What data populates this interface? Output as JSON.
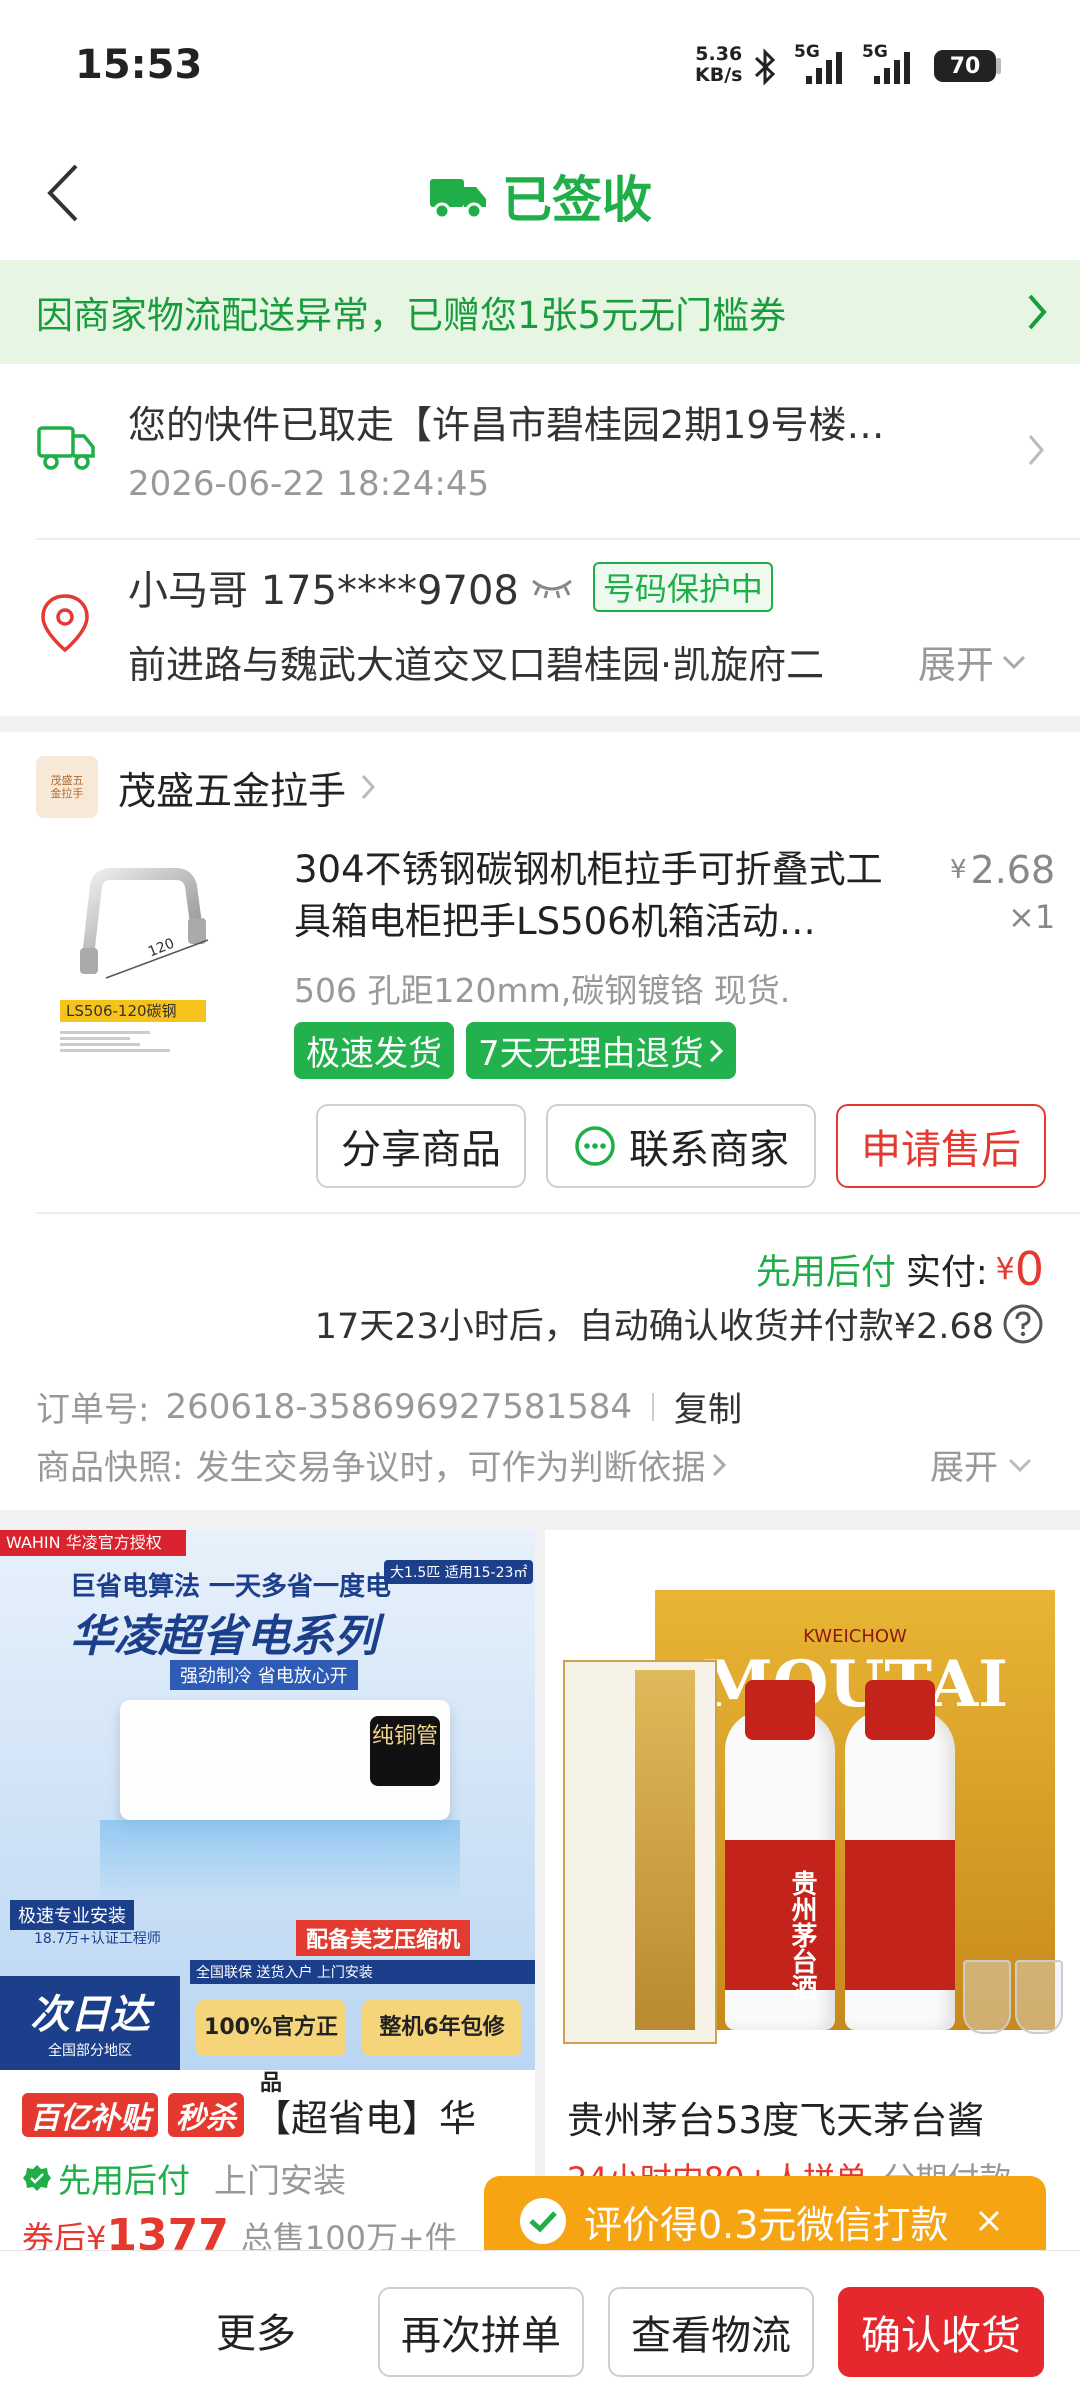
{
  "status_bar": {
    "time": "15:53",
    "net_speed_top": "5.36",
    "net_speed_bottom": "KB/s",
    "sig1": "5G",
    "sig2": "5G",
    "battery": "70"
  },
  "header": {
    "title": "已签收"
  },
  "notice": {
    "text": "因商家物流配送异常，已赠您1张5元无门槛券"
  },
  "shipping": {
    "status": "您的快件已取走【许昌市碧桂园2期19号楼…",
    "time": "2026-06-22 18:24:45"
  },
  "receiver": {
    "name_phone": "小马哥 175****9708",
    "protect": "号码保护中",
    "address": "前进路与魏武大道交叉口碧桂园·凯旋府二",
    "expand": "展开"
  },
  "store": {
    "logo_text": "茂盛五金拉手",
    "name": "茂盛五金拉手"
  },
  "product": {
    "title": "304不锈钢碳钢机柜拉手可折叠式工具箱电柜把手LS506机箱活动…",
    "spec": "506 孔距120mm,碳钢镀铬 现货.",
    "price_symbol": "¥",
    "price": "2.68",
    "qty": "×1",
    "img_label": "LS506-120碳钢",
    "img_dim": "120",
    "tag1": "极速发货",
    "tag2": "7天无理由退货"
  },
  "actions": {
    "share": "分享商品",
    "contact": "联系商家",
    "after_sale": "申请售后"
  },
  "payment": {
    "pay_later": "先用后付",
    "paid_label": "实付:",
    "paid_symbol": "¥",
    "paid_value": "0",
    "auto_confirm": "17天23小时后，自动确认收货并付款¥2.68"
  },
  "order": {
    "number_label": "订单号:",
    "number": "260618-358696927581584",
    "copy": "复制",
    "snapshot_label": "商品快照:",
    "snapshot_text": "发生交易争议时，可作为判断依据",
    "expand": "展开"
  },
  "recommend": [
    {
      "badge1": "百亿补贴",
      "badge2": "秒杀",
      "title": "【超省电】华",
      "pay_later": "先用后付",
      "service": "上门安装",
      "price_prefix": "券后¥",
      "price": "1377",
      "sales": "总售100万+件",
      "img_brand": "WAHIN 华凌官方授权",
      "img_head1": "巨省电算法 一天多省一度电",
      "img_head2": "华凌超省电系列",
      "img_sub": "强劲制冷 省电放心开",
      "img_tag": "大1.5匹 适用15-23㎡",
      "img_pure": "纯铜管",
      "img_compressor": "配备美芝压缩机",
      "img_install": "极速专业安装",
      "img_install2": "18.7万+认证工程师",
      "img_cidada": "次日达",
      "img_cidada2": "全国部分地区",
      "img_official": "100%官方正品",
      "img_warranty": "整机6年包修",
      "img_service": "全国联保 送货入户 上门安装"
    },
    {
      "title": "贵州茅台53度飞天茅台酱",
      "subtitle": "24小时内80+人拼单",
      "subtitle2": "分期付款",
      "img_brand": "MOUTAI",
      "img_brand_small": "KWEICHOW",
      "img_label": "贵州茅台酒"
    }
  ],
  "toast": {
    "text": "评价得0.3元微信打款"
  },
  "bottom_bar": {
    "more": "更多",
    "reorder": "再次拼单",
    "logistics": "查看物流",
    "confirm": "确认收货"
  }
}
